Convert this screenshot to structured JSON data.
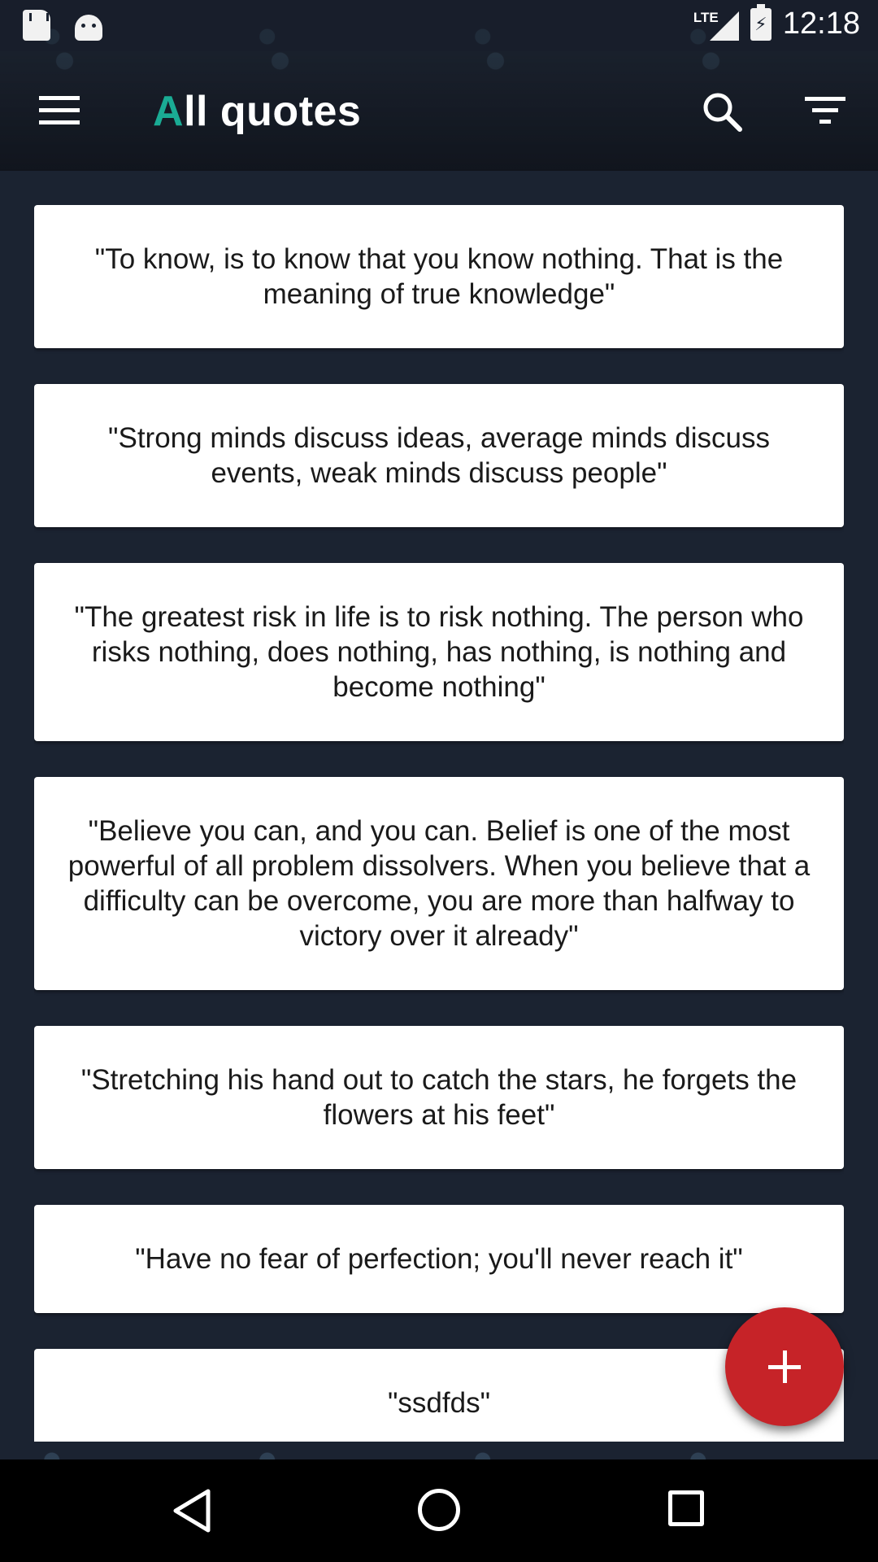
{
  "status_bar": {
    "time": "12:18",
    "network": "LTE",
    "icons": [
      "sd-card-icon",
      "android-icon",
      "lte-signal-icon",
      "battery-charging-icon"
    ]
  },
  "toolbar": {
    "title_first_letter": "A",
    "title_rest": "ll quotes",
    "accent_color": "#1aab94",
    "icons": [
      "menu-icon",
      "search-icon",
      "filter-icon"
    ]
  },
  "quotes": [
    "\"To know, is to know that you know nothing. That is the meaning of true knowledge\"",
    "\"Strong minds discuss ideas, average minds discuss events, weak minds discuss people\"",
    "\"The greatest risk in life is to risk nothing. The person who risks nothing, does nothing, has nothing, is nothing and become nothing\"",
    "\"Believe you can, and you can. Belief is one of the most powerful of all problem dissolvers. When you believe that a difficulty can be overcome, you are more than halfway to victory over it already\"",
    "\"Stretching his hand out to catch the stars, he forgets the flowers at his feet\"",
    "\"Have no fear of perfection; you'll never reach it\"",
    "\"ssdfds\""
  ],
  "fab": {
    "icon": "plus-icon",
    "color": "#c62328"
  },
  "nav_bar": {
    "icons": [
      "back-icon",
      "home-icon",
      "recents-icon"
    ]
  }
}
